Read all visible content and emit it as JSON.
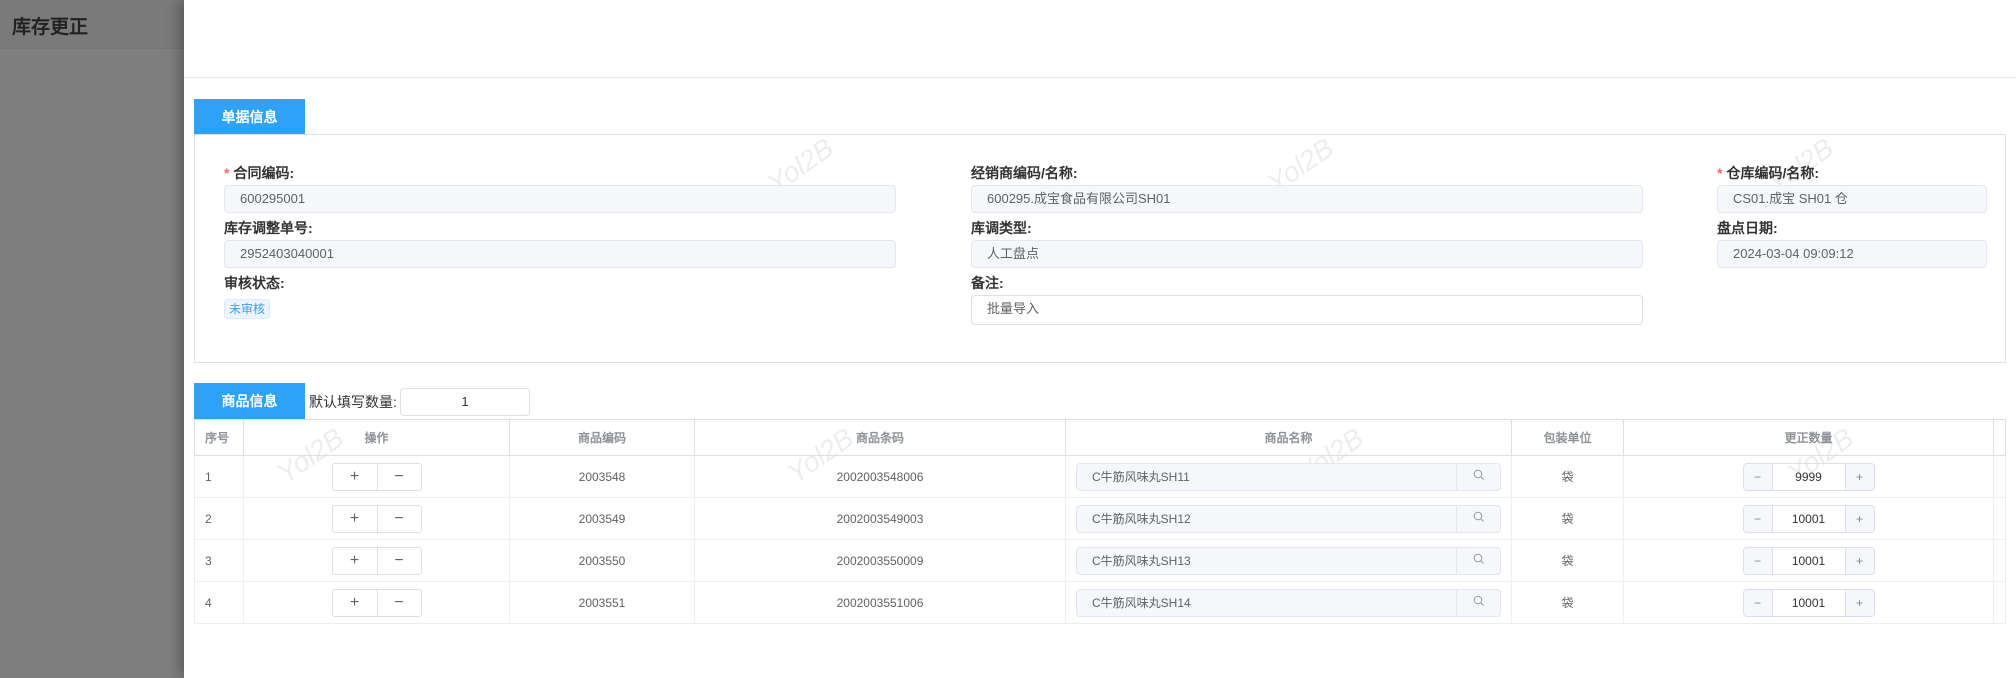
{
  "page_title": "库存更正",
  "watermark": "Yol2B",
  "doc_section": {
    "tab": "单据信息",
    "fields": {
      "contract_code": {
        "label": "合同编码:",
        "value": "600295001",
        "required": true
      },
      "dealer": {
        "label": "经销商编码/名称:",
        "value": "600295.成宝食品有限公司SH01"
      },
      "warehouse": {
        "label": "仓库编码/名称:",
        "value": "CS01.成宝 SH01 仓",
        "required": true
      },
      "adjust_no": {
        "label": "库存调整单号:",
        "value": "2952403040001"
      },
      "adjust_type": {
        "label": "库调类型:",
        "value": "人工盘点"
      },
      "count_date": {
        "label": "盘点日期:",
        "value": "2024-03-04 09:09:12"
      },
      "audit_status": {
        "label": "审核状态:",
        "value": "未审核"
      },
      "remark": {
        "label": "备注:",
        "value": "批量导入"
      }
    },
    "required_mark": "*"
  },
  "goods_section": {
    "tab": "商品信息",
    "default_qty_label": "默认填写数量:",
    "default_qty": "1",
    "columns": [
      "序号",
      "操作",
      "商品编码",
      "商品条码",
      "商品名称",
      "包装单位",
      "更正数量"
    ],
    "plus": "+",
    "minus": "−",
    "rows": [
      {
        "seq": "1",
        "code": "2003548",
        "barcode": "2002003548006",
        "name": "C牛筋风味丸SH11",
        "unit": "袋",
        "qty": "9999"
      },
      {
        "seq": "2",
        "code": "2003549",
        "barcode": "2002003549003",
        "name": "C牛筋风味丸SH12",
        "unit": "袋",
        "qty": "10001"
      },
      {
        "seq": "3",
        "code": "2003550",
        "barcode": "2002003550009",
        "name": "C牛筋风味丸SH13",
        "unit": "袋",
        "qty": "10001"
      },
      {
        "seq": "4",
        "code": "2003551",
        "barcode": "2002003551006",
        "name": "C牛筋风味丸SH14",
        "unit": "袋",
        "qty": "10001"
      }
    ]
  }
}
